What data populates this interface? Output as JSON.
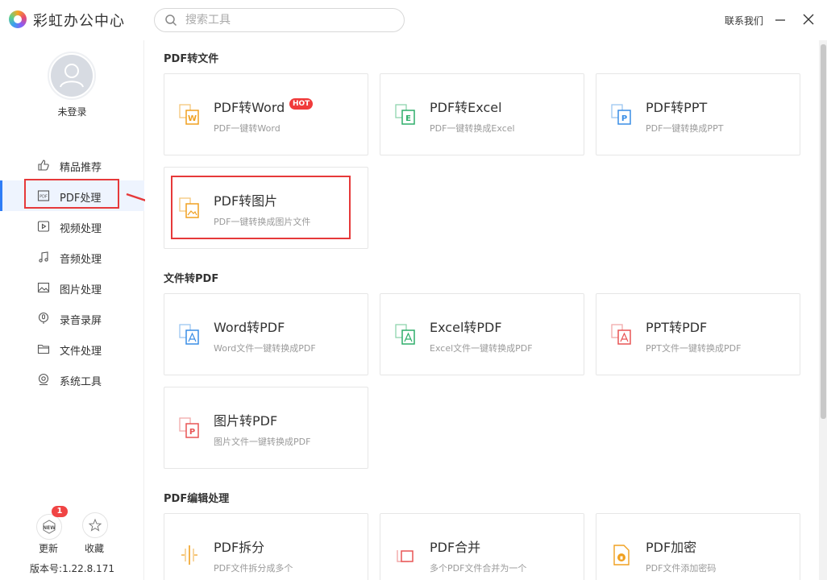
{
  "app": {
    "title": "彩虹办公中心"
  },
  "search": {
    "placeholder": "搜索工具"
  },
  "header": {
    "contact": "联系我们"
  },
  "user": {
    "login_label": "未登录"
  },
  "sidebar": {
    "items": [
      {
        "label": "精品推荐",
        "icon": "thumbs-up-icon"
      },
      {
        "label": "PDF处理",
        "icon": "pdf-icon"
      },
      {
        "label": "视频处理",
        "icon": "video-icon"
      },
      {
        "label": "音频处理",
        "icon": "music-icon"
      },
      {
        "label": "图片处理",
        "icon": "image-icon"
      },
      {
        "label": "录音录屏",
        "icon": "record-icon"
      },
      {
        "label": "文件处理",
        "icon": "folder-icon"
      },
      {
        "label": "系统工具",
        "icon": "system-icon"
      }
    ],
    "active_index": 1,
    "update_label": "更新",
    "update_badge": "1",
    "update_icon_text": "NEW",
    "favorite_label": "收藏",
    "version": "版本号:1.22.8.171"
  },
  "sections": [
    {
      "title": "PDF转文件",
      "cards": [
        {
          "title": "PDF转Word",
          "subtitle": "PDF一键转Word",
          "hot": "HOT",
          "icon": "word-doc-icon",
          "color": "#f0a020"
        },
        {
          "title": "PDF转Excel",
          "subtitle": "PDF一键转换成Excel",
          "icon": "excel-doc-icon",
          "color": "#2fae6a"
        },
        {
          "title": "PDF转PPT",
          "subtitle": "PDF一键转换成PPT",
          "icon": "ppt-doc-icon",
          "color": "#3a8ee6"
        },
        {
          "title": "PDF转图片",
          "subtitle": "PDF一键转换成图片文件",
          "icon": "image-doc-icon",
          "color": "#f0a020"
        }
      ]
    },
    {
      "title": "文件转PDF",
      "cards": [
        {
          "title": "Word转PDF",
          "subtitle": "Word文件一键转换成PDF",
          "icon": "word-to-pdf-icon",
          "color": "#3a8ee6"
        },
        {
          "title": "Excel转PDF",
          "subtitle": "Excel文件一键转换成PDF",
          "icon": "excel-to-pdf-icon",
          "color": "#2fae6a"
        },
        {
          "title": "PPT转PDF",
          "subtitle": "PPT文件一键转换成PDF",
          "icon": "ppt-to-pdf-icon",
          "color": "#e85555"
        },
        {
          "title": "图片转PDF",
          "subtitle": "图片文件一键转换成PDF",
          "icon": "image-to-pdf-icon",
          "color": "#e85555"
        }
      ]
    },
    {
      "title": "PDF编辑处理",
      "cards": [
        {
          "title": "PDF拆分",
          "subtitle": "PDF文件拆分成多个",
          "icon": "split-icon",
          "color": "#f0a020"
        },
        {
          "title": "PDF合并",
          "subtitle": "多个PDF文件合并为一个",
          "icon": "merge-icon",
          "color": "#e85555"
        },
        {
          "title": "PDF加密",
          "subtitle": "PDF文件添加密码",
          "icon": "lock-doc-icon",
          "color": "#f0a020"
        }
      ]
    }
  ]
}
